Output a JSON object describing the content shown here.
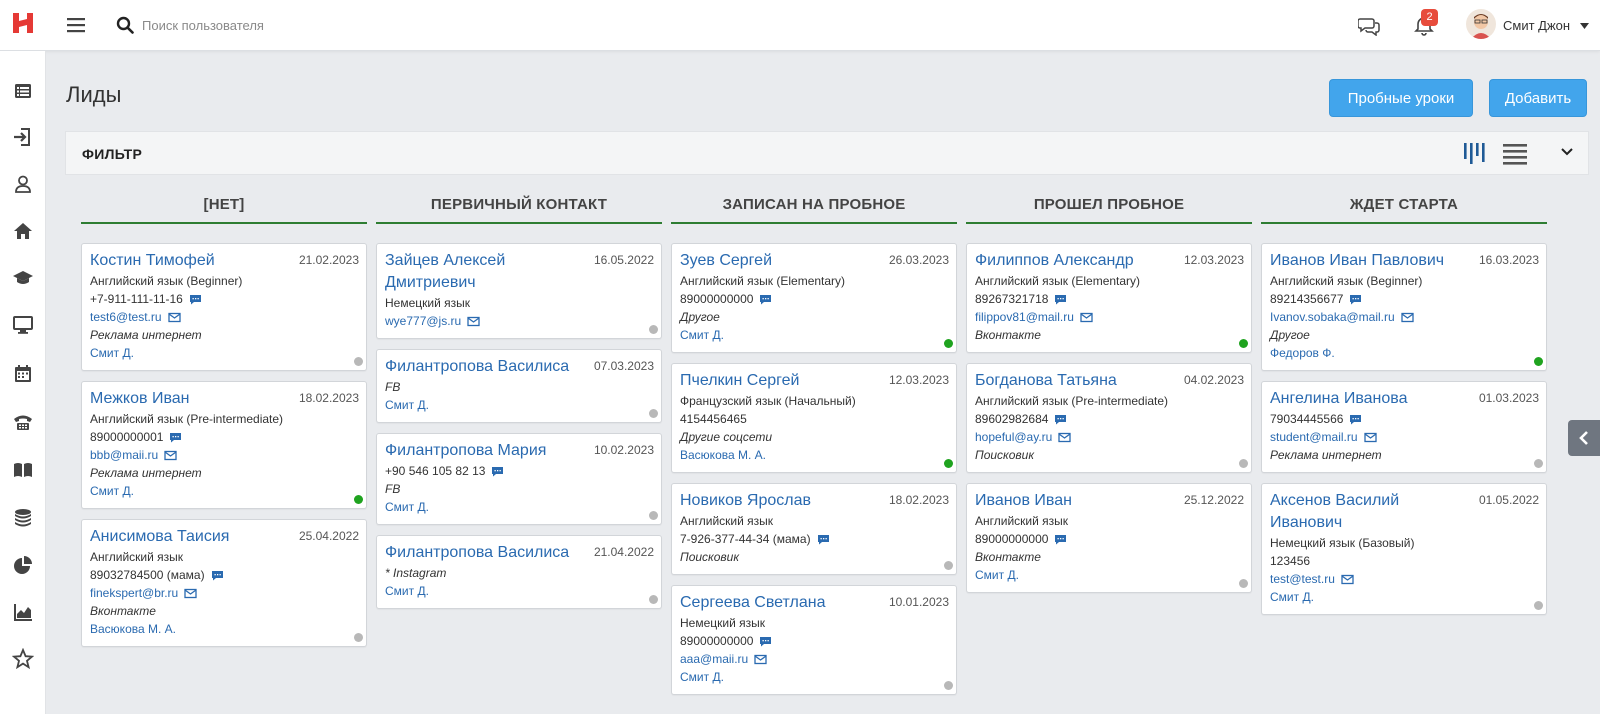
{
  "search": {
    "placeholder": "Поиск пользователя"
  },
  "user": {
    "name": "Смит Джон",
    "notifications": "2"
  },
  "page": {
    "title": "Лиды"
  },
  "buttons": {
    "trial": "Пробные уроки",
    "add": "Добавить"
  },
  "filter": {
    "title": "ФИЛЬТР"
  },
  "colors": {
    "accent": "#42a5ec",
    "link": "#2a6ab0",
    "column_line": "#2e7d32",
    "status_green": "#1fa31f",
    "status_grey": "#b8b8b8"
  },
  "sidebar_icons": [
    "list-icon",
    "import-icon",
    "user-icon",
    "home-icon",
    "graduation-cap-icon",
    "monitor-icon",
    "calendar-icon",
    "phone-icon",
    "book-icon",
    "coins-icon",
    "pie-chart-icon",
    "area-chart-icon",
    "star-icon"
  ],
  "columns": [
    {
      "title": "[НЕТ]",
      "cards": [
        {
          "name": "Костин Тимофей",
          "date": "21.02.2023",
          "lines": [
            {
              "text": "Английский язык (Beginner)",
              "style": ""
            },
            {
              "text": "+7-911-111-11-16",
              "style": "",
              "icon": "chat"
            },
            {
              "text": "test6@test.ru",
              "style": "link",
              "icon": "mail"
            },
            {
              "text": "Реклама интернет",
              "style": "italic"
            },
            {
              "text": "Смит Д.",
              "style": "link"
            }
          ],
          "status": "grey"
        },
        {
          "name": "Межков Иван",
          "date": "18.02.2023",
          "lines": [
            {
              "text": "Английский язык (Pre-intermediate)",
              "style": ""
            },
            {
              "text": "89000000001",
              "style": "",
              "icon": "chat"
            },
            {
              "text": "bbb@maii.ru",
              "style": "link",
              "icon": "mail"
            },
            {
              "text": "Реклама интернет",
              "style": "italic"
            },
            {
              "text": "Смит Д.",
              "style": "link"
            }
          ],
          "status": "green"
        },
        {
          "name": "Анисимова Таисия",
          "date": "25.04.2022",
          "lines": [
            {
              "text": "Английский язык",
              "style": ""
            },
            {
              "text": "89032784500 (мама)",
              "style": "",
              "icon": "chat"
            },
            {
              "text": "finekspert@br.ru",
              "style": "link",
              "icon": "mail"
            },
            {
              "text": "Вконтакте",
              "style": "italic"
            },
            {
              "text": "Васюкова М. А.",
              "style": "link"
            }
          ],
          "status": "grey"
        }
      ]
    },
    {
      "title": "ПЕРВИЧНЫЙ КОНТАКТ",
      "cards": [
        {
          "name": "Зайцев Алексей Дмитриевич",
          "date": "16.05.2022",
          "lines": [
            {
              "text": "Немецкий язык",
              "style": ""
            },
            {
              "text": "wye777@js.ru",
              "style": "link",
              "icon": "mail"
            }
          ],
          "status": "grey"
        },
        {
          "name": "Филантропова Василиса",
          "date": "07.03.2023",
          "lines": [
            {
              "text": "FB",
              "style": "italic"
            },
            {
              "text": "Смит Д.",
              "style": "link"
            }
          ],
          "status": "grey"
        },
        {
          "name": "Филантропова Мария",
          "date": "10.02.2023",
          "lines": [
            {
              "text": "+90 546 105 82 13",
              "style": "",
              "icon": "chat"
            },
            {
              "text": "FB",
              "style": "italic"
            },
            {
              "text": "Смит Д.",
              "style": "link"
            }
          ],
          "status": "grey"
        },
        {
          "name": "Филантропова Василиса",
          "date": "21.04.2022",
          "lines": [
            {
              "text": "* Instagram",
              "style": "italic"
            },
            {
              "text": "Смит Д.",
              "style": "link"
            }
          ],
          "status": "grey"
        }
      ]
    },
    {
      "title": "ЗАПИСАН НА ПРОБНОЕ",
      "cards": [
        {
          "name": "Зуев Сергей",
          "date": "26.03.2023",
          "lines": [
            {
              "text": "Английский язык (Elementary)",
              "style": ""
            },
            {
              "text": "89000000000",
              "style": "",
              "icon": "chat"
            },
            {
              "text": "Другое",
              "style": "italic"
            },
            {
              "text": "Смит Д.",
              "style": "link"
            }
          ],
          "status": "green"
        },
        {
          "name": "Пчелкин Сергей",
          "date": "12.03.2023",
          "lines": [
            {
              "text": "Французский язык (Начальный)",
              "style": ""
            },
            {
              "text": "4154456465",
              "style": ""
            },
            {
              "text": "Другие соцсети",
              "style": "italic"
            },
            {
              "text": "Васюкова М. А.",
              "style": "link"
            }
          ],
          "status": "green"
        },
        {
          "name": "Новиков Ярослав",
          "date": "18.02.2023",
          "lines": [
            {
              "text": "Английский язык",
              "style": ""
            },
            {
              "text": "7-926-377-44-34 (мама)",
              "style": "",
              "icon": "chat"
            },
            {
              "text": "Поисковик",
              "style": "italic"
            }
          ],
          "status": "grey"
        },
        {
          "name": "Сергеева Светлана",
          "date": "10.01.2023",
          "lines": [
            {
              "text": "Немецкий язык",
              "style": ""
            },
            {
              "text": "89000000000",
              "style": "",
              "icon": "chat"
            },
            {
              "text": "aaa@maii.ru",
              "style": "link",
              "icon": "mail"
            },
            {
              "text": "Смит Д.",
              "style": "link"
            }
          ],
          "status": "grey"
        }
      ]
    },
    {
      "title": "ПРОШЕЛ ПРОБНОЕ",
      "cards": [
        {
          "name": "Филиппов Александр",
          "date": "12.03.2023",
          "lines": [
            {
              "text": "Английский язык (Elementary)",
              "style": ""
            },
            {
              "text": "89267321718",
              "style": "",
              "icon": "chat"
            },
            {
              "text": "filippov81@mail.ru",
              "style": "link",
              "icon": "mail"
            },
            {
              "text": "Вконтакте",
              "style": "italic"
            }
          ],
          "status": "green"
        },
        {
          "name": "Богданова Татьяна",
          "date": "04.02.2023",
          "lines": [
            {
              "text": "Английский язык (Pre-intermediate)",
              "style": ""
            },
            {
              "text": "89602982684",
              "style": "",
              "icon": "chat"
            },
            {
              "text": "hopeful@ay.ru",
              "style": "link",
              "icon": "mail"
            },
            {
              "text": "Поисковик",
              "style": "italic"
            }
          ],
          "status": "grey"
        },
        {
          "name": "Иванов Иван",
          "date": "25.12.2022",
          "lines": [
            {
              "text": "Английский язык",
              "style": ""
            },
            {
              "text": "89000000000",
              "style": "",
              "icon": "chat"
            },
            {
              "text": "Вконтакте",
              "style": "italic"
            },
            {
              "text": "Смит Д.",
              "style": "link"
            }
          ],
          "status": "grey"
        }
      ]
    },
    {
      "title": "ЖДЕТ СТАРТА",
      "cards": [
        {
          "name": "Иванов Иван Павлович",
          "date": "16.03.2023",
          "lines": [
            {
              "text": "Английский язык (Beginner)",
              "style": ""
            },
            {
              "text": "89214356677",
              "style": "",
              "icon": "chat"
            },
            {
              "text": "Ivanov.sobaka@mail.ru",
              "style": "link",
              "icon": "mail"
            },
            {
              "text": "Другое",
              "style": "italic"
            },
            {
              "text": "Федоров Ф.",
              "style": "link"
            }
          ],
          "status": "green"
        },
        {
          "name": "Ангелина Иванова",
          "date": "01.03.2023",
          "lines": [
            {
              "text": "79034445566",
              "style": "",
              "icon": "chat"
            },
            {
              "text": "student@mail.ru",
              "style": "link",
              "icon": "mail"
            },
            {
              "text": "Реклама интернет",
              "style": "italic"
            }
          ],
          "status": "grey"
        },
        {
          "name": "Аксенов Василий Иванович",
          "date": "01.05.2022",
          "lines": [
            {
              "text": "Немецкий язык (Базовый)",
              "style": ""
            },
            {
              "text": "123456",
              "style": ""
            },
            {
              "text": "test@test.ru",
              "style": "link",
              "icon": "mail"
            },
            {
              "text": "Смит Д.",
              "style": "link"
            }
          ],
          "status": "grey"
        }
      ]
    }
  ]
}
